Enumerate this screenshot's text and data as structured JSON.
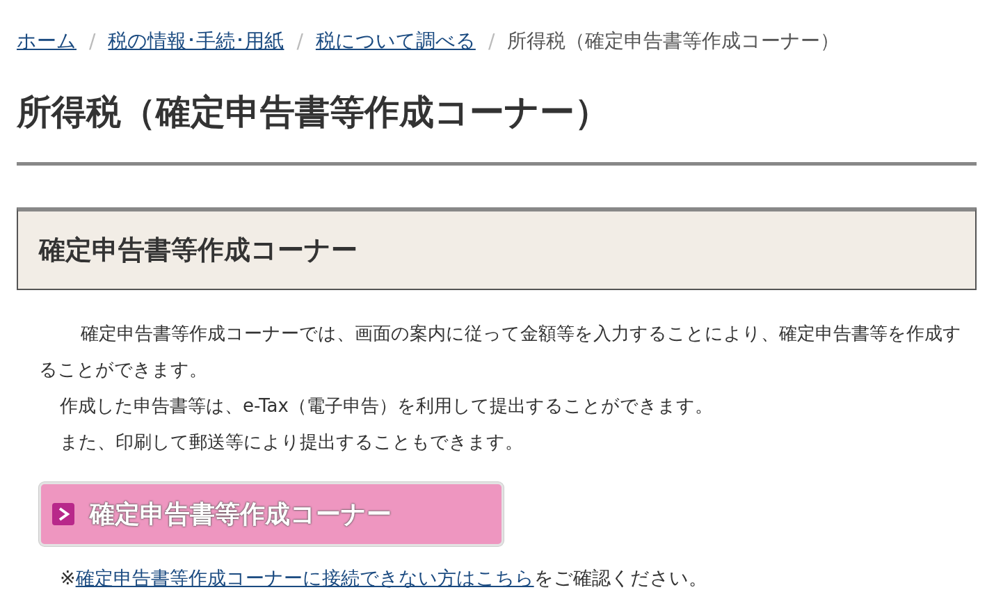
{
  "breadcrumb": {
    "separator": "/",
    "items": [
      {
        "label": "ホーム",
        "link": true
      },
      {
        "label": "税の情報･手続･用紙",
        "link": true
      },
      {
        "label": "税について調べる",
        "link": true
      },
      {
        "label": "所得税（確定申告書等作成コーナー）",
        "link": false
      }
    ]
  },
  "page_title": "所得税（確定申告書等作成コーナー）",
  "section": {
    "heading": "確定申告書等作成コーナー",
    "paragraphs": [
      {
        "text": "確定申告書等作成コーナーでは、画面の案内に従って金額等を入力することにより、確定申告書等を作成することができます。",
        "kind": "lead"
      },
      {
        "text": "作成した申告書等は、e-Tax（電子申告）を利用して提出することができます。",
        "kind": "body"
      },
      {
        "text": "また、印刷して郵送等により提出することもできます。",
        "kind": "body"
      }
    ],
    "button": "確定申告書等作成コーナー",
    "note": {
      "prefix": "※",
      "link": "確定申告書等作成コーナーに接続できない方はこちら",
      "suffix": "をご確認ください。"
    }
  }
}
